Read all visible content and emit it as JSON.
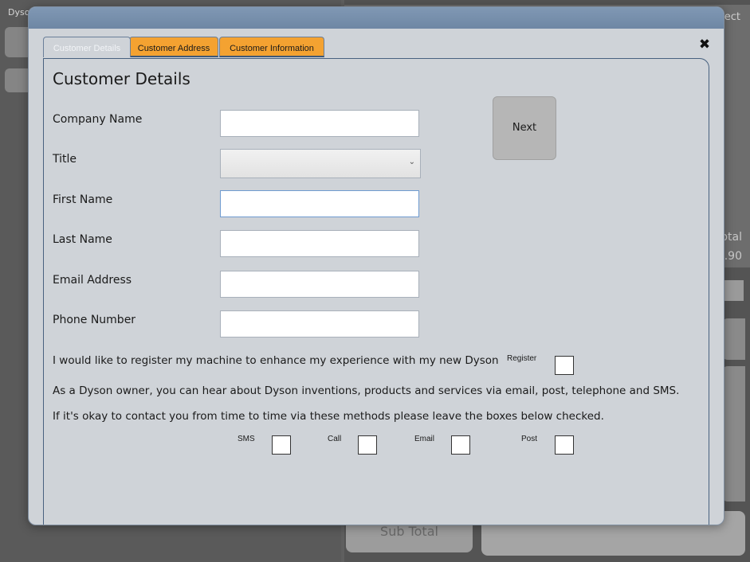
{
  "background": {
    "left_title": "Dyso",
    "right_header": "ect",
    "right_total_label": "otal",
    "right_total_value": ".90",
    "subtotal_label": "Sub Total"
  },
  "modal": {
    "close_glyph": "✖",
    "tabs": [
      {
        "label": "Customer Details",
        "active": true
      },
      {
        "label": "Customer Address",
        "active": false
      },
      {
        "label": "Customer Information",
        "active": false
      }
    ],
    "heading": "Customer Details",
    "next_label": "Next",
    "fields": {
      "company_name": {
        "label": "Company Name",
        "value": ""
      },
      "title": {
        "label": "Title",
        "value": ""
      },
      "first_name": {
        "label": "First Name",
        "value": ""
      },
      "last_name": {
        "label": "Last Name",
        "value": ""
      },
      "email": {
        "label": "Email Address",
        "value": ""
      },
      "phone": {
        "label": "Phone Number",
        "value": ""
      }
    },
    "register_text": "I would like to register my machine to enhance my experience with my new Dyson",
    "register_label": "Register",
    "owner_text": "As a Dyson owner, you can hear about Dyson inventions, products and services via email, post, telephone and SMS.",
    "contact_text": "If it's okay to contact you from time to time via these methods please leave the boxes below checked.",
    "contact_options": {
      "sms": "SMS",
      "call": "Call",
      "email": "Email",
      "post": "Post"
    }
  }
}
